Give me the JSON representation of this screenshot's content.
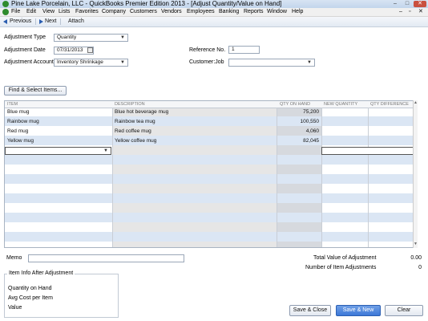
{
  "window": {
    "title": "Pine Lake Porcelain, LLC  - QuickBooks Premier Edition 2013 - [Adjust Quantity/Value on Hand]",
    "min": "–",
    "max": "□",
    "close": "✕"
  },
  "menu": {
    "items": [
      "File",
      "Edit",
      "View",
      "Lists",
      "Favorites",
      "Company",
      "Customers",
      "Vendors",
      "Employees",
      "Banking",
      "Reports",
      "Window",
      "Help"
    ],
    "win_min": "–",
    "win_restore": "▫",
    "win_close": "✕"
  },
  "toolbar": {
    "previous": "Previous",
    "next": "Next",
    "attach": "Attach"
  },
  "form": {
    "adjustment_type_label": "Adjustment Type",
    "adjustment_type_value": "Quantity",
    "adjustment_date_label": "Adjustment Date",
    "adjustment_date_value": "07/31/2013",
    "adjustment_account_label": "Adjustment Account",
    "adjustment_account_value": "Inventory Shrinkage",
    "reference_no_label": "Reference No.",
    "reference_no_value": "1",
    "customer_job_label": "Customer:Job",
    "customer_job_value": "",
    "find_select_button": "Find & Select Items..."
  },
  "table": {
    "headers": {
      "item": "ITEM",
      "description": "DESCRIPTION",
      "qty_on_hand": "QTY ON HAND",
      "new_quantity": "NEW QUANTITY",
      "qty_difference": "QTY DIFFERENCE"
    },
    "rows": [
      {
        "item": "Blue mug",
        "description": "Blue hot beverage mug",
        "qty_on_hand": "75,200",
        "new_quantity": "",
        "qty_difference": ""
      },
      {
        "item": "Rainbow mug",
        "description": "Rainbow tea mug",
        "qty_on_hand": "100,550",
        "new_quantity": "",
        "qty_difference": ""
      },
      {
        "item": "Red mug",
        "description": "Red coffee mug",
        "qty_on_hand": "4,060",
        "new_quantity": "",
        "qty_difference": ""
      },
      {
        "item": "Yellow mug",
        "description": "Yellow coffee mug",
        "qty_on_hand": "82,045",
        "new_quantity": "",
        "qty_difference": ""
      }
    ]
  },
  "bottom": {
    "memo_label": "Memo",
    "memo_value": "",
    "total_value_label": "Total Value of Adjustment",
    "total_value": "0.00",
    "num_adjustments_label": "Number of Item Adjustments",
    "num_adjustments": "0",
    "info_box_title": "Item Info After Adjustment",
    "info_qty": "Quantity on Hand",
    "info_avg_cost": "Avg Cost per Item",
    "info_value": "Value",
    "save_close": "Save & Close",
    "save_new": "Save & New",
    "clear": "Clear"
  },
  "colors": {
    "accent": "#3d78d8",
    "row_alt": "#dbe6f4"
  }
}
